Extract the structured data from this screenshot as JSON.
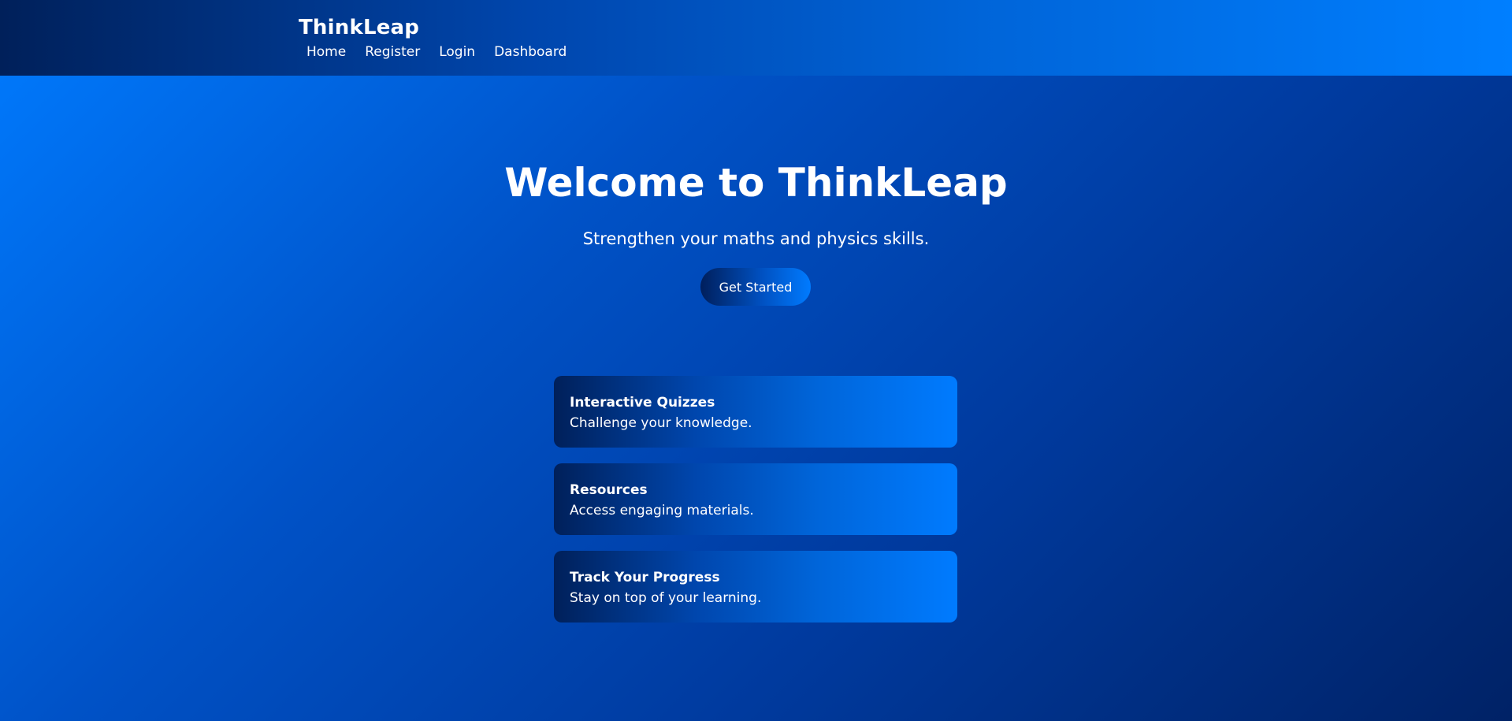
{
  "header": {
    "brand": "ThinkLeap",
    "nav": [
      {
        "label": "Home"
      },
      {
        "label": "Register"
      },
      {
        "label": "Login"
      },
      {
        "label": "Dashboard"
      }
    ]
  },
  "hero": {
    "title": "Welcome to ThinkLeap",
    "subtitle": "Strengthen your maths and physics skills.",
    "cta_label": "Get Started"
  },
  "features": [
    {
      "title": "Interactive Quizzes",
      "description": "Challenge your knowledge."
    },
    {
      "title": "Resources",
      "description": "Access engaging materials."
    },
    {
      "title": "Track Your Progress",
      "description": "Stay on top of your learning."
    }
  ],
  "colors": {
    "brand_blue": "#007bff",
    "deep_navy": "#00205a",
    "text": "#ffffff"
  }
}
